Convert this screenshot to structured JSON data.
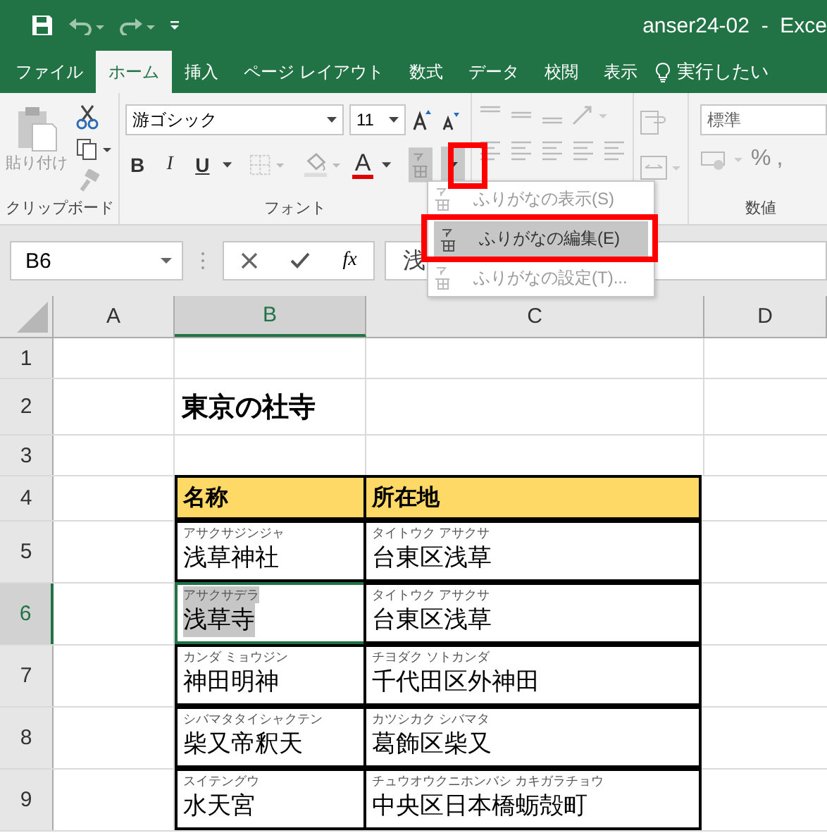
{
  "title_bar": {
    "title": "anser24-02  -  Exce"
  },
  "tabs": [
    {
      "label": "ファイル",
      "selected": false
    },
    {
      "label": "ホーム",
      "selected": true
    },
    {
      "label": "挿入",
      "selected": false
    },
    {
      "label": "ページ レイアウト",
      "selected": false
    },
    {
      "label": "数式",
      "selected": false
    },
    {
      "label": "データ",
      "selected": false
    },
    {
      "label": "校閲",
      "selected": false
    },
    {
      "label": "表示",
      "selected": false
    }
  ],
  "tell_me": {
    "placeholder": "実行したい"
  },
  "ribbon": {
    "paste_label": "貼り付け",
    "font_name": "游ゴシック",
    "font_size": "11",
    "bold": "B",
    "italic": "I",
    "underline": "U",
    "font_color_label": "A",
    "number_format": "標準",
    "percent": "%",
    "comma": ",",
    "groups": [
      "クリップボード",
      "フォント",
      "数値"
    ]
  },
  "furigana_menu": {
    "items": [
      {
        "label": "ふりがなの表示(S)",
        "disabled": true,
        "selected": false
      },
      {
        "label": "ふりがなの編集(E)",
        "disabled": false,
        "selected": true
      },
      {
        "label": "ふりがなの設定(T)...",
        "disabled": true,
        "selected": false
      }
    ]
  },
  "formula_bar": {
    "name_box": "B6",
    "fx": "fx",
    "value": "浅"
  },
  "columns": [
    {
      "label": "A",
      "selected": false
    },
    {
      "label": "B",
      "selected": true
    },
    {
      "label": "C",
      "selected": false
    },
    {
      "label": "D",
      "selected": false
    }
  ],
  "rows": [
    {
      "number": "1",
      "kind": "blank",
      "selected": false
    },
    {
      "number": "2",
      "kind": "title",
      "selected": false,
      "text": "東京の社寺"
    },
    {
      "number": "3",
      "kind": "blank",
      "selected": false
    },
    {
      "number": "4",
      "kind": "header",
      "selected": false,
      "cells": [
        "名称",
        "所在地"
      ]
    },
    {
      "number": "5",
      "kind": "entry",
      "selected": false,
      "name": {
        "ruby": "アサクサジンジャ",
        "text": "浅草神社"
      },
      "address": {
        "ruby": "タイトウク アサクサ",
        "text": "台東区浅草"
      }
    },
    {
      "number": "6",
      "kind": "entry",
      "selected": true,
      "name": {
        "ruby": "アサクサデラ",
        "text": "浅草寺"
      },
      "address": {
        "ruby": "タイトウク アサクサ",
        "text": "台東区浅草"
      }
    },
    {
      "number": "7",
      "kind": "entry",
      "selected": false,
      "name": {
        "ruby": "カンダ ミョウジン",
        "text": "神田明神"
      },
      "address": {
        "ruby": "チヨダク ソトカンダ",
        "text": "千代田区外神田"
      }
    },
    {
      "number": "8",
      "kind": "entry",
      "selected": false,
      "name": {
        "ruby": "シバマタタイシャクテン",
        "text": "柴又帝釈天"
      },
      "address": {
        "ruby": "カツシカク シバマタ",
        "text": "葛飾区柴又"
      }
    },
    {
      "number": "9",
      "kind": "entry",
      "selected": false,
      "name": {
        "ruby": "スイテングウ",
        "text": "水天宮"
      },
      "address": {
        "ruby": "チュウオウクニホンバシ カキガラチョウ",
        "text": "中央区日本橋蛎殻町"
      }
    }
  ]
}
